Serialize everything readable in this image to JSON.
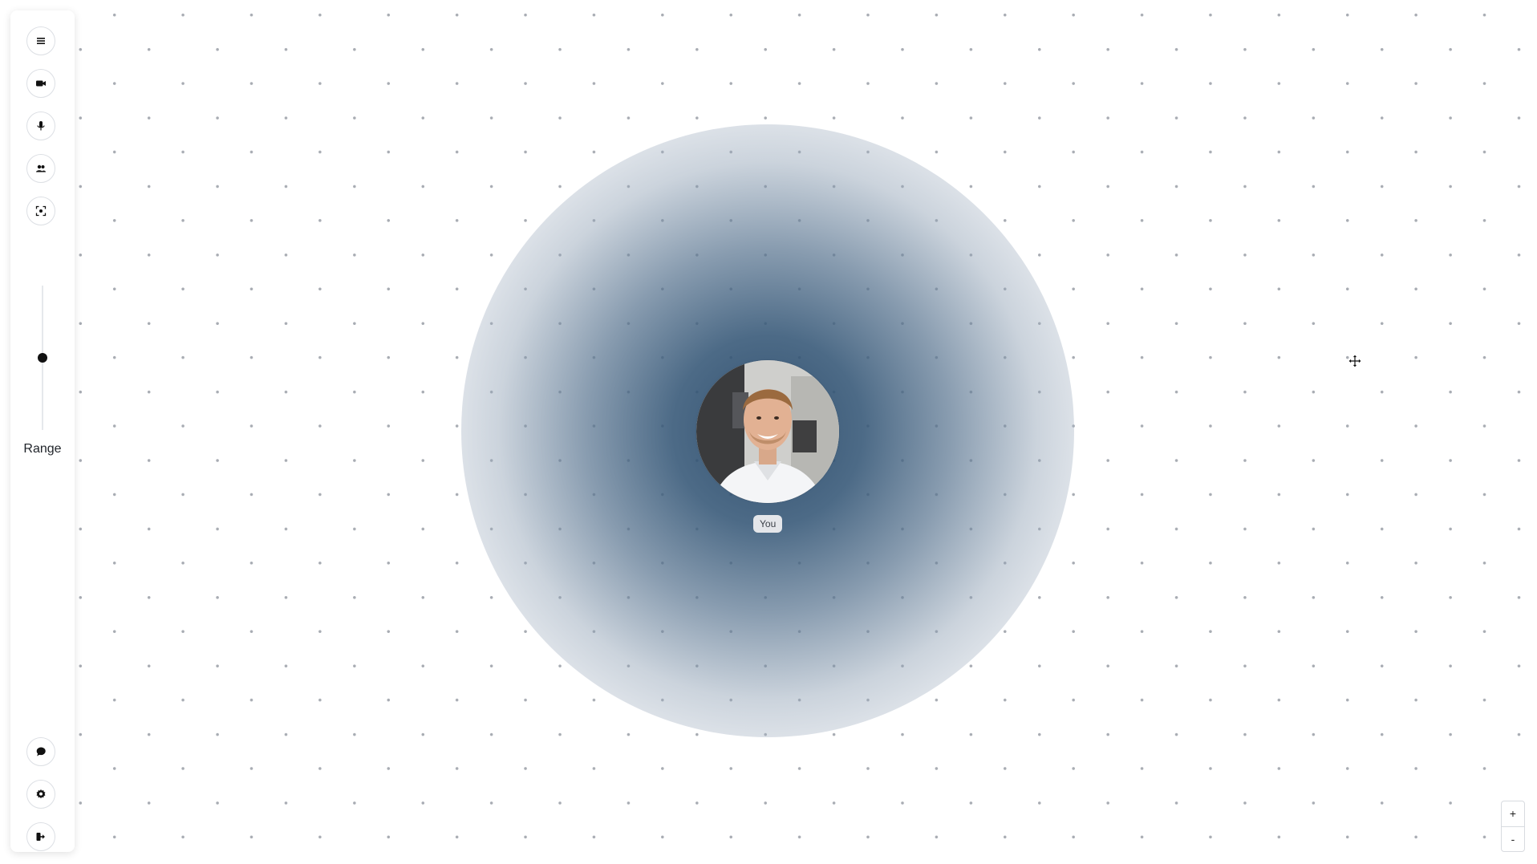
{
  "canvas": {
    "participant": {
      "name": "You"
    },
    "colors": {
      "range_glow": "#2f5373",
      "dots": "#a8acb3"
    }
  },
  "toolbar": {
    "top_buttons": [
      {
        "icon": "menu-icon"
      },
      {
        "icon": "video-camera-icon"
      },
      {
        "icon": "microphone-icon"
      },
      {
        "icon": "participants-icon"
      },
      {
        "icon": "focus-frame-icon"
      }
    ],
    "range": {
      "label": "Range",
      "value": 0.5
    },
    "bottom_buttons": [
      {
        "icon": "chat-icon"
      },
      {
        "icon": "gear-icon"
      },
      {
        "icon": "leave-icon"
      }
    ]
  },
  "zoom": {
    "in_label": "+",
    "out_label": "-"
  },
  "cursor": {
    "icon": "move-cursor-icon"
  }
}
